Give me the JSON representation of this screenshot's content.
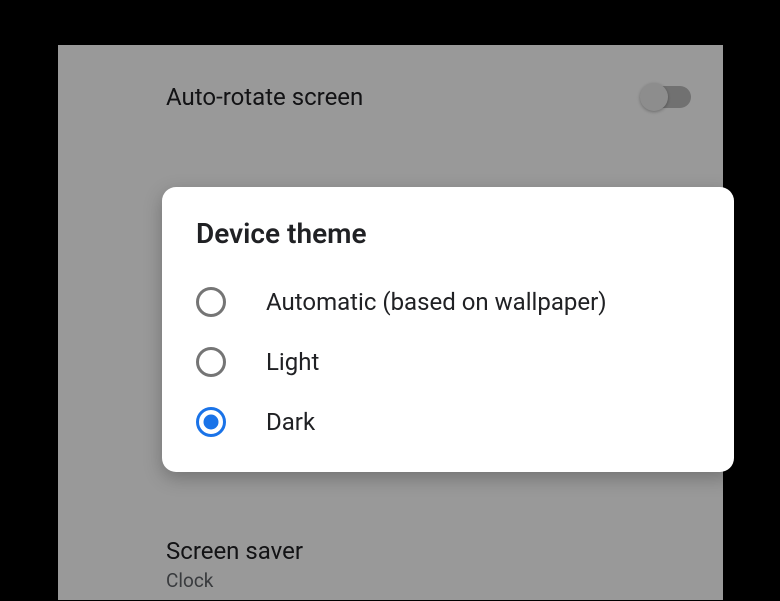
{
  "settings": {
    "autoRotate": {
      "label": "Auto-rotate screen",
      "enabled": false
    },
    "screenSaver": {
      "label": "Screen saver",
      "value": "Clock"
    }
  },
  "dialog": {
    "title": "Device theme",
    "options": [
      {
        "label": "Automatic (based on wallpaper)",
        "selected": false
      },
      {
        "label": "Light",
        "selected": false
      },
      {
        "label": "Dark",
        "selected": true
      }
    ]
  }
}
